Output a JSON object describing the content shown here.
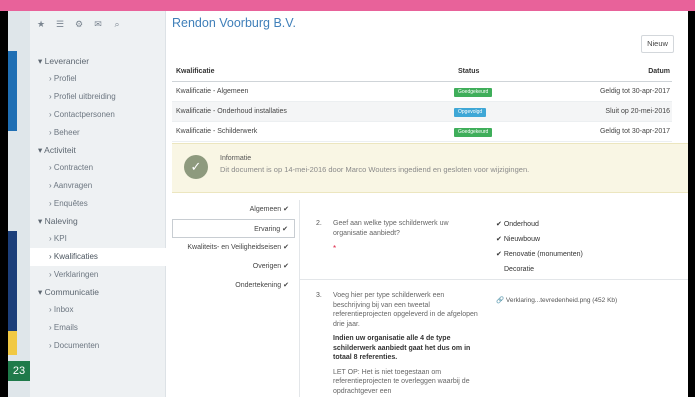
{
  "left_badge": "23",
  "company_title": "Rendon Voorburg B.V.",
  "new_button": "Nieuw",
  "sidebar": {
    "icons": [
      "★",
      "☰",
      "⚙",
      "✉",
      "⌕"
    ],
    "sections": [
      {
        "title": "Leverancier",
        "items": [
          "Profiel",
          "Profiel uitbreiding",
          "Contactpersonen",
          "Beheer"
        ]
      },
      {
        "title": "Activiteit",
        "items": [
          "Contracten",
          "Aanvragen",
          "Enquêtes"
        ]
      },
      {
        "title": "Naleving",
        "items": [
          "KPI",
          "Kwalificaties",
          "Verklaringen"
        ]
      },
      {
        "title": "Communicatie",
        "items": [
          "Inbox",
          "Emails",
          "Documenten"
        ]
      }
    ]
  },
  "table": {
    "headers": [
      "Kwalificatie",
      "Status",
      "Datum"
    ],
    "rows": [
      {
        "name": "Kwalificatie - Algemeen",
        "status": "Goedgekeurd",
        "status_color": "#3fae5a",
        "date": "Geldig tot 30-apr-2017"
      },
      {
        "name": "Kwalificatie - Onderhoud installaties",
        "status": "Opgevolgd",
        "status_color": "#3fa7d6",
        "date": "Sluit op 20-mei-2016"
      },
      {
        "name": "Kwalificatie - Schilderwerk",
        "status": "Goedgekeurd",
        "status_color": "#3fae5a",
        "date": "Geldig tot 30-apr-2017"
      }
    ]
  },
  "info": {
    "title": "Informatie",
    "text": "Dit document is op 14-mei-2016 door Marco Wouters ingediend en gesloten voor wijzigingen."
  },
  "steps": [
    {
      "label": "Algemeen",
      "check": "✔"
    },
    {
      "label": "Ervaring",
      "check": "✔"
    },
    {
      "label": "Kwaliteits- en Veiligheidseisen",
      "check": "✔"
    },
    {
      "label": "Overigen",
      "check": "✔"
    },
    {
      "label": "Ondertekening",
      "check": "✔"
    }
  ],
  "q2": {
    "number": "2.",
    "text": "Geef aan welke type schilderwerk uw organisatie aanbiedt?",
    "required": "*",
    "answers": [
      {
        "label": "Onderhoud",
        "checked": "✔"
      },
      {
        "label": "Nieuwbouw",
        "checked": "✔"
      },
      {
        "label": "Renovatie (monumenten)",
        "checked": "✔"
      },
      {
        "label": "Decoratie",
        "checked": ""
      }
    ]
  },
  "q3": {
    "number": "3.",
    "para1": "Voeg hier per type schilderwerk een beschrijving bij van een tweetal referentieprojecten opgeleverd in de afgelopen drie jaar.",
    "para2": "Indien uw organisatie alle 4 de type schilderwerk aanbiedt gaat het dus om in totaal 8 referenties.",
    "para3": "LET OP: Het is niet toegestaan om referentieprojecten te overleggen waarbij de opdrachtgever een",
    "attachment": "Verklaring...tevredenheid.png (452 Kb)"
  }
}
